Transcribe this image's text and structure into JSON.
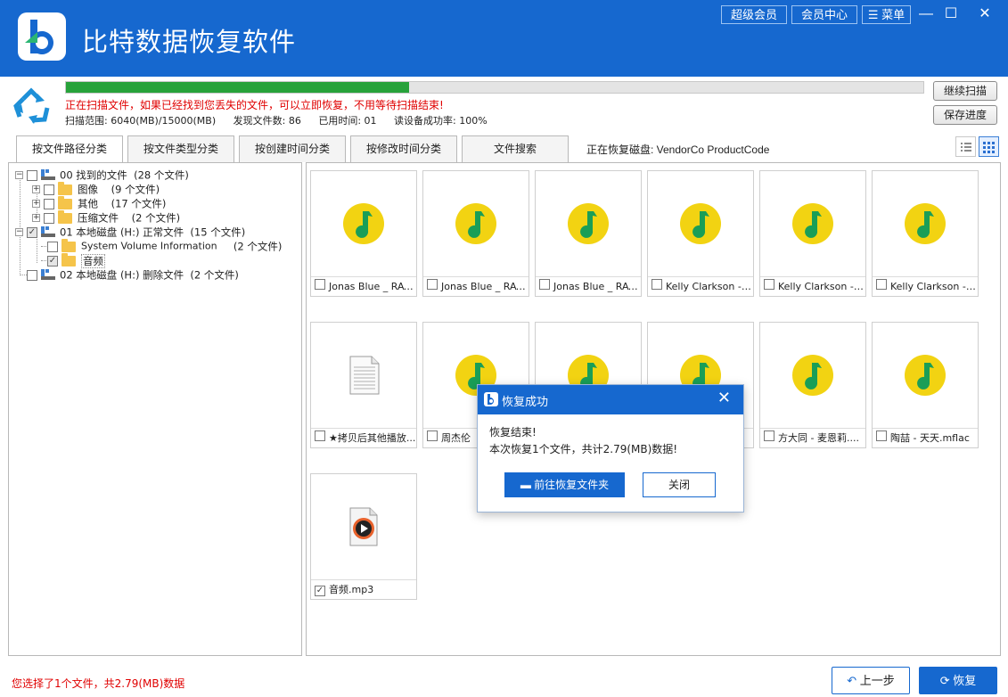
{
  "app": {
    "title": "比特数据恢复软件"
  },
  "titlebar": {
    "buttons": [
      "超级会员",
      "会员中心",
      "菜单"
    ],
    "minimize": "—",
    "maximize": "☐",
    "close": "✕"
  },
  "scan": {
    "progress_percent": 40,
    "warning": "正在扫描文件，如果已经找到您丢失的文件，可以立即恢复，不用等待扫描结束!",
    "range": "扫描范围: 6040(MB)/15000(MB)",
    "found": "发现文件数: 86",
    "elapsed": "已用时间: 01",
    "read_rate": "读设备成功率: 100%",
    "continue_label": "继续扫描",
    "save_label": "保存进度"
  },
  "tabs": [
    "按文件路径分类",
    "按文件类型分类",
    "按创建时间分类",
    "按修改时间分类",
    "文件搜索"
  ],
  "recovering_disk": "正在恢复磁盘: VendorCo ProductCode",
  "tree": [
    {
      "label": "00 找到的文件",
      "count": "(28 个文件)"
    },
    {
      "label": "图像",
      "count": "(9 个文件)"
    },
    {
      "label": "其他",
      "count": "(17 个文件)"
    },
    {
      "label": "压缩文件",
      "count": "(2 个文件)"
    },
    {
      "label": "01 本地磁盘 (H:) 正常文件",
      "count": "(15 个文件)"
    },
    {
      "label": "System Volume Information",
      "count": "(2 个文件)"
    },
    {
      "label": "音频",
      "count": ""
    },
    {
      "label": "02 本地磁盘 (H:) 删除文件",
      "count": "(2 个文件)"
    }
  ],
  "files": [
    "Jonas Blue _ RAYE...",
    "Jonas Blue _ RAYE...",
    "Jonas Blue _ RAYE...",
    "Kelly Clarkson - C...",
    "Kelly Clarkson - C...",
    "Kelly Clarkson - C...",
    "★拷贝后其他播放...",
    "周杰伦",
    "",
    "",
    "方大同 - 麦恩莉....",
    "陶喆 - 天天.mflac",
    "音频.mp3"
  ],
  "dialog": {
    "title": "恢复成功",
    "line1": "恢复结束!",
    "line2": "本次恢复1个文件，共计2.79(MB)数据!",
    "goto_label": "前往恢复文件夹",
    "close_label": "关闭"
  },
  "status": "您选择了1个文件，共2.79(MB)数据",
  "nav": {
    "back_label": "上一步",
    "recover_label": "恢复"
  },
  "colors": {
    "brand": "#1668cf",
    "progress": "#27a23a",
    "alert": "#e00000",
    "music_icon": "#f2d312",
    "music_note": "#1a9e57"
  }
}
